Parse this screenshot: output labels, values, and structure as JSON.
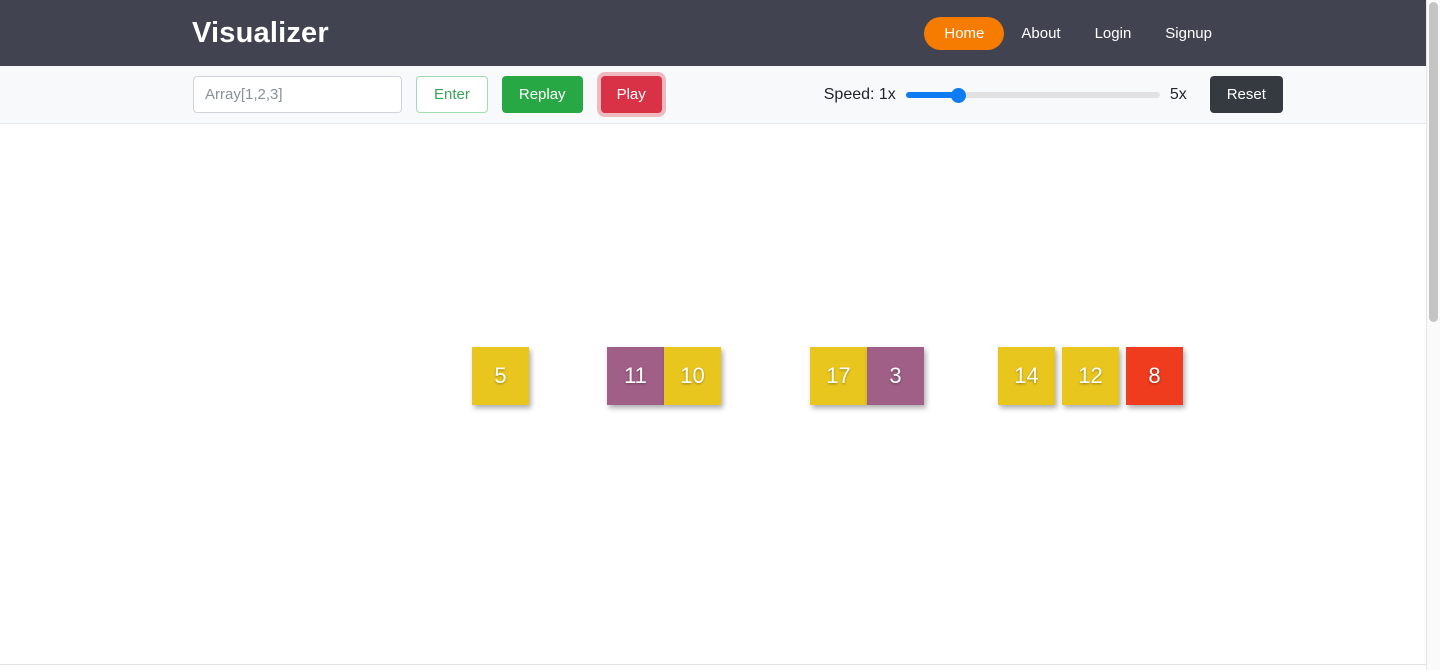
{
  "navbar": {
    "brand": "Visualizer",
    "links": [
      {
        "label": "Home",
        "active": true
      },
      {
        "label": "About",
        "active": false
      },
      {
        "label": "Login",
        "active": false
      },
      {
        "label": "Signup",
        "active": false
      }
    ],
    "background_color": "#414350",
    "active_color": "#f57c00"
  },
  "toolbar": {
    "array_input": {
      "value": "",
      "placeholder": "Array[1,2,3]"
    },
    "enter_label": "Enter",
    "replay_label": "Replay",
    "play_label": "Play",
    "reset_label": "Reset",
    "speed_label": "Speed: 1x",
    "speed_max_label": "5x",
    "speed_value": 1,
    "speed_min": 1,
    "speed_max": 5,
    "background_color": "#f8f9fa"
  },
  "visualization": {
    "colors": {
      "default": "#e8c61e",
      "comparing": "#a05f86",
      "highlight": "#ef3b1e"
    },
    "groups": [
      {
        "blocks": [
          {
            "value": "5",
            "state": "default"
          }
        ]
      },
      {
        "blocks": [
          {
            "value": "11",
            "state": "comparing"
          },
          {
            "value": "10",
            "state": "default"
          }
        ]
      },
      {
        "blocks": [
          {
            "value": "17",
            "state": "default"
          },
          {
            "value": "3",
            "state": "comparing"
          }
        ]
      },
      {
        "blocks": [
          {
            "value": "14",
            "state": "default"
          }
        ]
      },
      {
        "blocks": [
          {
            "value": "12",
            "state": "default"
          }
        ]
      },
      {
        "blocks": [
          {
            "value": "8",
            "state": "highlight"
          }
        ]
      }
    ],
    "group_gaps": [
      0,
      78,
      89,
      74,
      7,
      7
    ]
  }
}
